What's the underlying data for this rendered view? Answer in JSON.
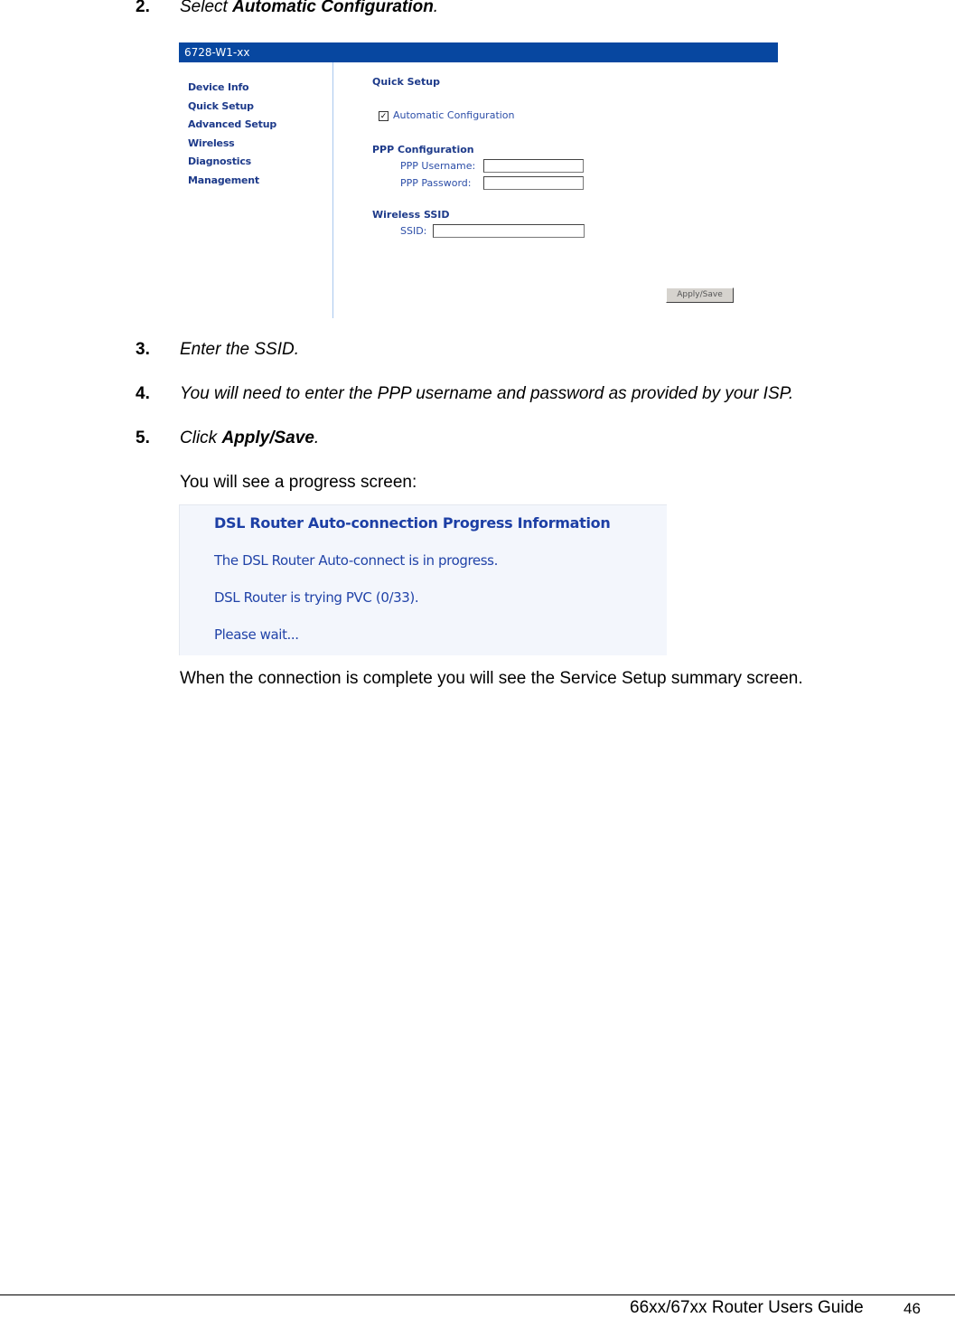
{
  "steps": [
    {
      "number": "2.",
      "prefix": "Select ",
      "bold": "Automatic Configuration",
      "suffix": "."
    },
    {
      "number": "3.",
      "text": "Enter the SSID."
    },
    {
      "number": "4.",
      "text": "You will need to enter the PPP username and password as provided by your ISP."
    },
    {
      "number": "5.",
      "prefix": "Click ",
      "bold": "Apply/Save",
      "suffix": "."
    }
  ],
  "router_screen": {
    "title": "6728-W1-xx",
    "nav_items": [
      "Device Info",
      "Quick Setup",
      "Advanced Setup",
      "Wireless",
      "Diagnostics",
      "Management"
    ],
    "page_heading": "Quick Setup",
    "auto_config": {
      "label": "Automatic Configuration",
      "checked": true,
      "check_glyph": "✓"
    },
    "ppp_section": "PPP Configuration",
    "ppp_username_label": "PPP Username:",
    "ppp_username_value": "",
    "ppp_password_label": "PPP Password:",
    "ppp_password_value": "",
    "wireless_section": "Wireless SSID",
    "ssid_label": "SSID:",
    "ssid_value": "",
    "apply_button": "Apply/Save",
    "colors": {
      "titlebar": "#0747a0",
      "link": "#1d3a8a",
      "divider": "#a9c8ee"
    }
  },
  "progress_intro": "You will see a progress screen:",
  "progress_screen": {
    "title": "DSL Router Auto-connection Progress Information",
    "lines": [
      "The DSL Router Auto-connect is in progress.",
      "DSL Router is trying PVC (0/33).",
      "Please wait..."
    ]
  },
  "completion_text": "When the connection is complete you will see the Service Setup summary screen.",
  "footer": {
    "guide_title": "66xx/67xx Router Users Guide",
    "page_number": "46"
  }
}
